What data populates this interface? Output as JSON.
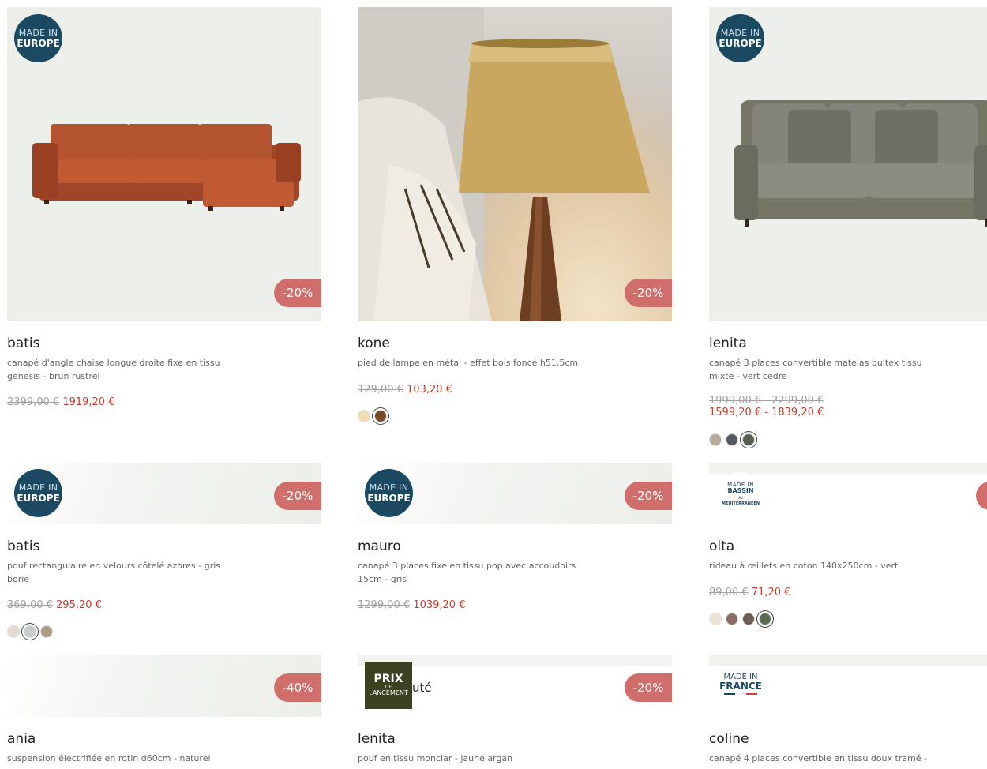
{
  "products": [
    {
      "name": "batis",
      "description": "canapé d'angle chaise longue droite fixe en tissu genesis - brun rustrel",
      "old_price": "2399,00 €",
      "new_price": "1919,20 €",
      "discount": "-20%",
      "badge_line1": "MADE IN",
      "badge_line2": "EUROPE"
    },
    {
      "name": "kone",
      "description": "pied de lampe en métal - effet bois foncé h51,5cm",
      "old_price": "129,00 €",
      "new_price": "103,20 €",
      "discount": "-20%",
      "swatches": [
        "#f0ddb0",
        "#7a4a2a"
      ],
      "selected_swatch": 1
    },
    {
      "name": "lenita",
      "description": "canapé 3 places convertible matelas bultex tissu mixte - vert cedre",
      "old_price": "1999,00 € - 2299,00 €",
      "new_price": "1599,20 € - 1839,20 €",
      "badge_line1": "MADE IN",
      "badge_line2": "EUROPE",
      "swatches": [
        "#b5ab9a",
        "#555a60",
        "#57614f"
      ],
      "selected_swatch": 2
    },
    {
      "name": "batis",
      "description": "pouf rectangulaire en velours côtelé azores - gris borie",
      "old_price": "369,00 €",
      "new_price": "295,20 €",
      "discount": "-20%",
      "badge_line1": "MADE IN",
      "badge_line2": "EUROPE",
      "swatches": [
        "#e3dace",
        "#c7cdcc",
        "#ad9c87"
      ],
      "selected_swatch": 1
    },
    {
      "name": "mauro",
      "description": "canapé 3 places fixe en tissu pop avec accoudoirs 15cm - gris",
      "old_price": "1299,00 €",
      "new_price": "1039,20 €",
      "discount": "-20%",
      "badge_line1": "MADE IN",
      "badge_line2": "EUROPE"
    },
    {
      "name": "olta",
      "description": "rideau à œillets en coton 140x250cm - vert",
      "old_price": "89,00 €",
      "new_price": "71,20 €",
      "badge_line1": "MADE IN",
      "badge_line2": "BASSIN",
      "badge_line3": "MEDITERRANEEN",
      "swatches": [
        "#ece3d6",
        "#8b6d65",
        "#6d5e55",
        "#5b6b56"
      ],
      "selected_swatch": 3
    },
    {
      "name": "ania",
      "description": "suspension électrifiée en rotin d60cm - naturel",
      "discount": "-40%"
    },
    {
      "name": "lenita",
      "description": "pouf en tissu monclar - jaune argan",
      "discount": "-20%",
      "badge_line1": "PRIX",
      "badge_line2": "DE",
      "badge_line3": "LANCEMENT",
      "badge_suffix": "uté"
    },
    {
      "name": "coline",
      "description": "canapé 4 places convertible en tissu doux tramé -",
      "badge_line1": "MADE IN",
      "badge_line2": "FRANCE"
    }
  ],
  "colors": {
    "discount": "#cf6e6a",
    "new_price": "#c43d2c",
    "badge_eu": "#1b4962",
    "badge_launch": "#3b4221"
  }
}
